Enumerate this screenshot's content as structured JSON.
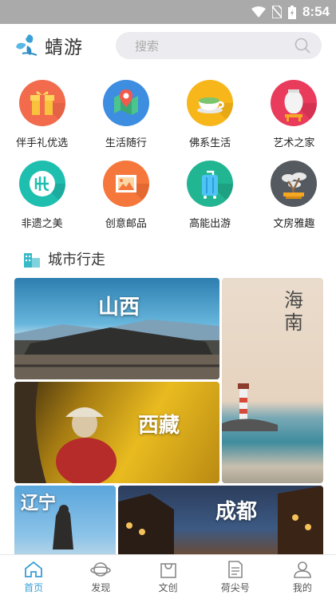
{
  "status_bar": {
    "time": "8:54"
  },
  "header": {
    "app_name": "蜻游",
    "search_placeholder": "搜索"
  },
  "categories": [
    {
      "label": "伴手礼优选",
      "icon": "gift-icon",
      "color": "#f26b4c"
    },
    {
      "label": "生活随行",
      "icon": "map-pin-icon",
      "color": "#3d8de0"
    },
    {
      "label": "佛系生活",
      "icon": "tea-cup-icon",
      "color": "#f7b61a"
    },
    {
      "label": "艺术之家",
      "icon": "vase-icon",
      "color": "#e93c5c"
    },
    {
      "label": "非遗之美",
      "icon": "heritage-seal-icon",
      "color": "#1fbfb0"
    },
    {
      "label": "创意邮品",
      "icon": "stamp-icon",
      "color": "#f5773b"
    },
    {
      "label": "高能出游",
      "icon": "luggage-icon",
      "color": "#22b592"
    },
    {
      "label": "文房雅趣",
      "icon": "bonsai-icon",
      "color": "#555a60"
    }
  ],
  "section": {
    "title": "城市行走"
  },
  "cities": [
    {
      "name": "山西"
    },
    {
      "name": "海南"
    },
    {
      "name": "西藏"
    },
    {
      "name": "辽宁"
    },
    {
      "name": "成都"
    }
  ],
  "tabs": [
    {
      "label": "首页",
      "icon": "home-icon",
      "active": true
    },
    {
      "label": "发现",
      "icon": "planet-icon",
      "active": false
    },
    {
      "label": "文创",
      "icon": "shopping-bag-icon",
      "active": false
    },
    {
      "label": "荷尖号",
      "icon": "article-icon",
      "active": false
    },
    {
      "label": "我的",
      "icon": "user-icon",
      "active": false
    }
  ]
}
